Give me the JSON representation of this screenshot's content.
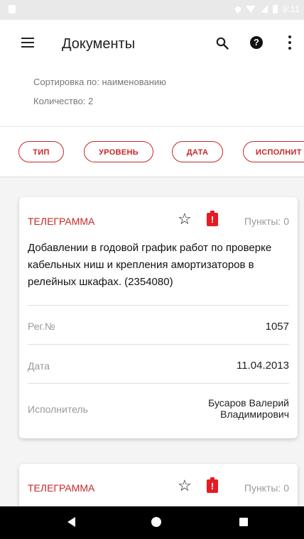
{
  "status_bar": {
    "time": "9:11"
  },
  "app_bar": {
    "title": "Документы"
  },
  "info": {
    "sort_text": "Сортировка по: наименованию",
    "count_text": "Количество: 2"
  },
  "filters": [
    {
      "label": "ТИП"
    },
    {
      "label": "УРОВЕНЬ"
    },
    {
      "label": "ДАТА"
    },
    {
      "label": "ИСПОЛНИТ"
    }
  ],
  "documents": [
    {
      "type": "ТЕЛЕГРАММА",
      "points": "Пункты: 0",
      "description": "Добавлении в годовой график работ по проверке кабельных ниш и крепления амортизаторов в релейных шкафах. (2354080)",
      "reg_label": "Рег.№",
      "reg_value": "1057",
      "date_label": "Дата",
      "date_value": "11.04.2013",
      "executor_label": "Исполнитель",
      "executor_value": "Бусаров Валерий Владимирович"
    },
    {
      "type": "ТЕЛЕГРАММА",
      "points": "Пункты: 0"
    }
  ],
  "colors": {
    "accent": "#c62828",
    "flag": "#e51c23",
    "background": "#f4f4f4"
  },
  "icons": {
    "menu": "menu-icon",
    "search": "search-icon",
    "help": "help-icon",
    "more": "more-vert-icon",
    "favorite": "star-outline-icon",
    "priority": "priority-flag-icon",
    "nav_back": "back-icon",
    "nav_home": "home-icon",
    "nav_recent": "recent-apps-icon"
  }
}
